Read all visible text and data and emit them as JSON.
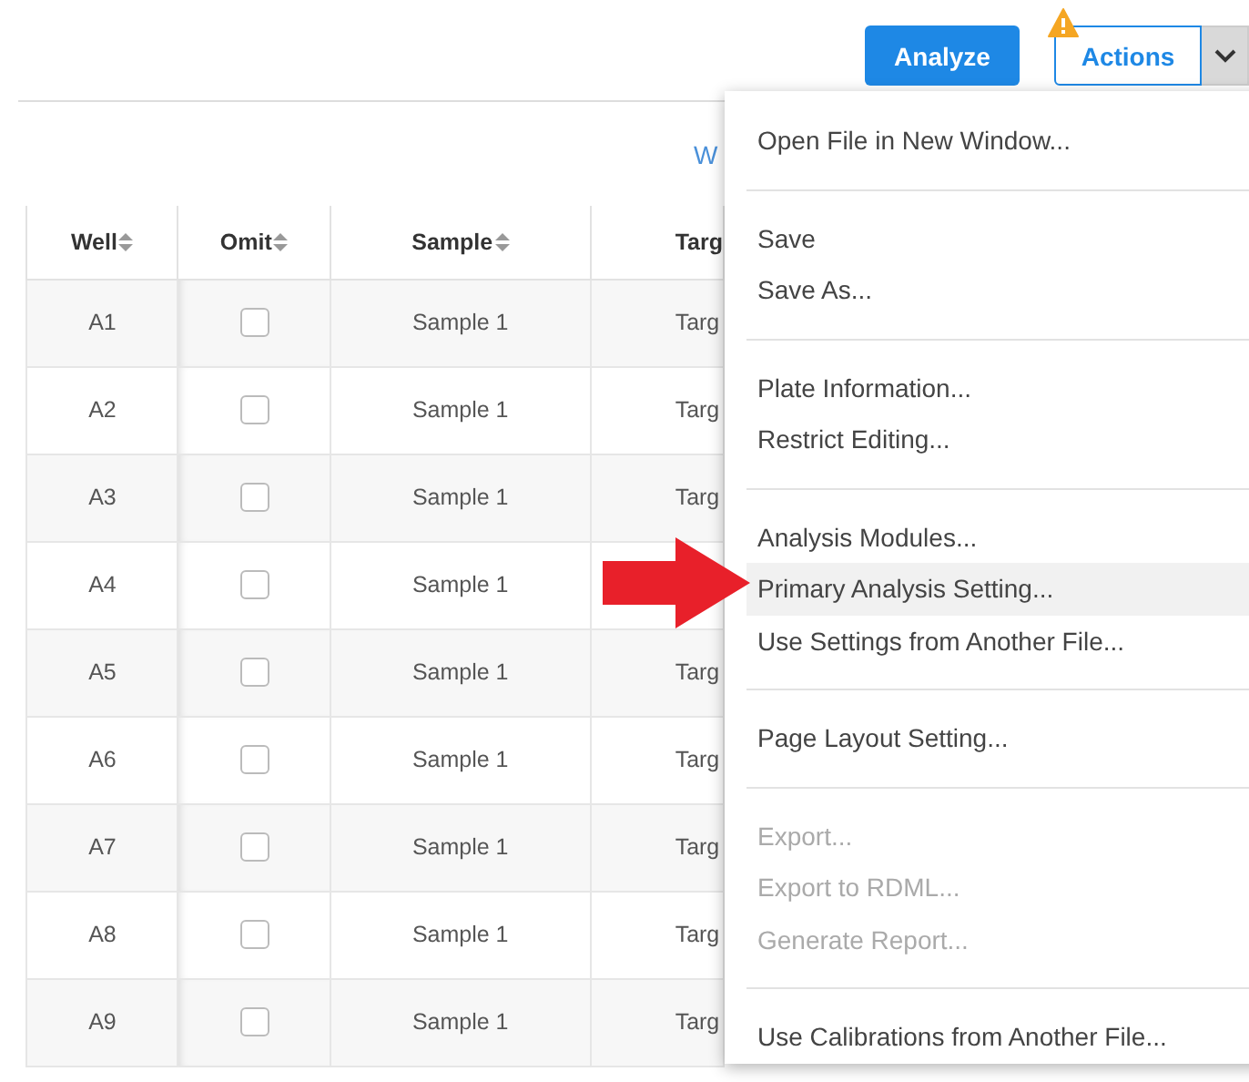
{
  "toolbar": {
    "analyze_button": "Analyze",
    "actions_button": "Actions"
  },
  "link_fragment": "W",
  "table": {
    "columns": [
      {
        "label": "Well",
        "sortable": true
      },
      {
        "label": "Omit",
        "sortable": true
      },
      {
        "label": "Sample",
        "sortable": true
      },
      {
        "label": "Targ",
        "sortable": false
      }
    ],
    "rows": [
      {
        "well": "A1",
        "omit": false,
        "sample": "Sample 1",
        "target": "Targ"
      },
      {
        "well": "A2",
        "omit": false,
        "sample": "Sample 1",
        "target": "Targ"
      },
      {
        "well": "A3",
        "omit": false,
        "sample": "Sample 1",
        "target": "Targ"
      },
      {
        "well": "A4",
        "omit": false,
        "sample": "Sample 1"
      },
      {
        "well": "A5",
        "omit": false,
        "sample": "Sample 1",
        "target": "Targ"
      },
      {
        "well": "A6",
        "omit": false,
        "sample": "Sample 1",
        "target": "Targ"
      },
      {
        "well": "A7",
        "omit": false,
        "sample": "Sample 1",
        "target": "Targ"
      },
      {
        "well": "A8",
        "omit": false,
        "sample": "Sample 1",
        "target": "Targ"
      },
      {
        "well": "A9",
        "omit": false,
        "sample": "Sample 1",
        "target": "Targ"
      }
    ]
  },
  "actions_menu": {
    "groups": [
      [
        {
          "label": "Open File in New Window...",
          "disabled": false,
          "highlighted": false
        }
      ],
      [
        {
          "label": "Save",
          "disabled": false,
          "highlighted": false
        },
        {
          "label": "Save As...",
          "disabled": false,
          "highlighted": false
        }
      ],
      [
        {
          "label": "Plate Information...",
          "disabled": false,
          "highlighted": false
        },
        {
          "label": "Restrict Editing...",
          "disabled": false,
          "highlighted": false
        }
      ],
      [
        {
          "label": "Analysis Modules...",
          "disabled": false,
          "highlighted": false
        },
        {
          "label": "Primary Analysis Setting...",
          "disabled": false,
          "highlighted": true
        },
        {
          "label": "Use Settings from Another File...",
          "disabled": false,
          "highlighted": false
        }
      ],
      [
        {
          "label": "Page Layout Setting...",
          "disabled": false,
          "highlighted": false
        }
      ],
      [
        {
          "label": "Export...",
          "disabled": true,
          "highlighted": false
        },
        {
          "label": "Export to RDML...",
          "disabled": true,
          "highlighted": false
        },
        {
          "label": "Generate Report...",
          "disabled": true,
          "highlighted": false
        }
      ],
      [
        {
          "label": "Use Calibrations from Another File...",
          "disabled": false,
          "highlighted": false
        }
      ]
    ]
  }
}
